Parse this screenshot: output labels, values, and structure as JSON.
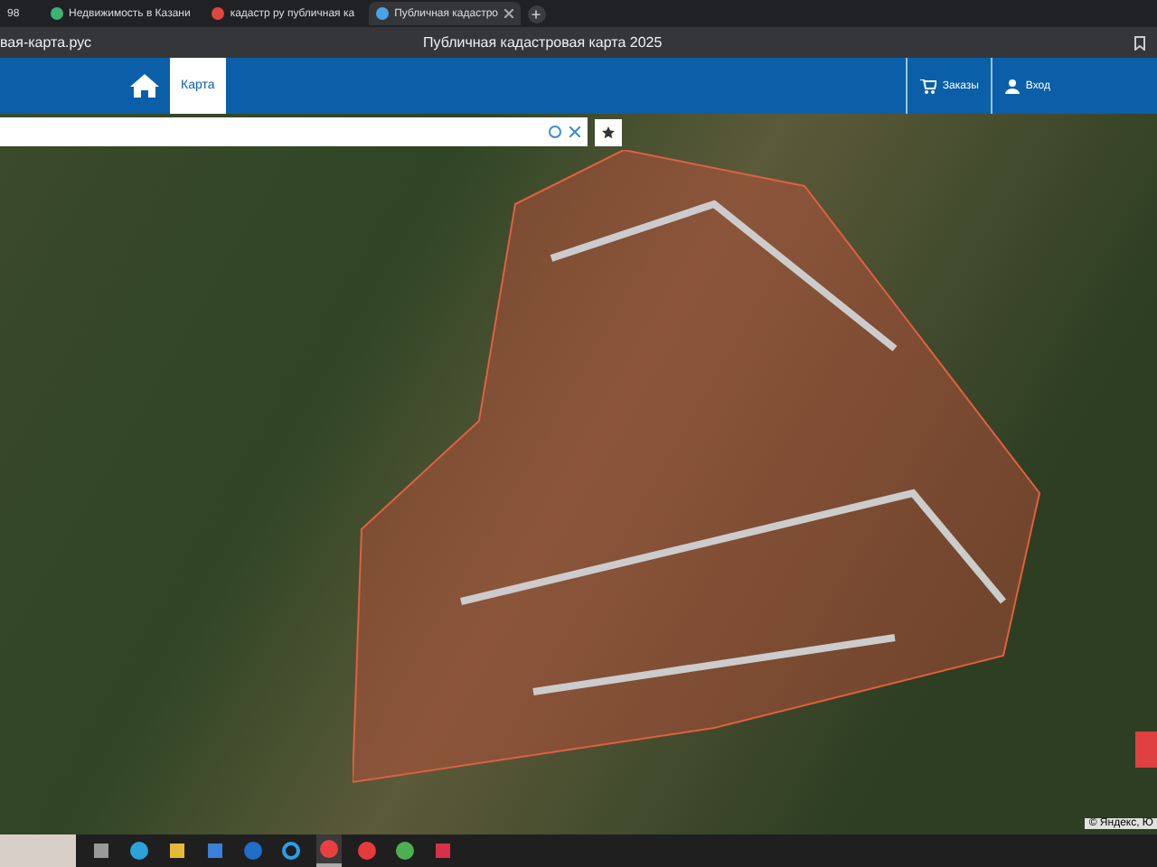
{
  "browser": {
    "tabs": [
      {
        "title": "98",
        "selected": false
      },
      {
        "title": "Недвижимость в Казани",
        "selected": false
      },
      {
        "title": "кадастр ру публичная ка",
        "selected": false
      },
      {
        "title": "Публичная кадастро",
        "selected": true
      }
    ],
    "new_tab": "+",
    "address": "вая-карта.рус",
    "page_title": "Публичная кадастровая карта 2025"
  },
  "header": {
    "nav": [
      {
        "label": "Карта",
        "selected": true
      }
    ],
    "actions": [
      {
        "kind": "cart",
        "label": "Заказы"
      },
      {
        "kind": "user",
        "label": "Вход"
      }
    ]
  },
  "map": {
    "attribution": "© Яндекс, Ю"
  },
  "taskbar": {
    "apps": [
      {
        "kind": "taskview",
        "active": false
      },
      {
        "kind": "edge",
        "active": false
      },
      {
        "kind": "folder",
        "active": false
      },
      {
        "kind": "store",
        "active": false
      },
      {
        "kind": "mail",
        "active": false
      },
      {
        "kind": "ring",
        "active": false
      },
      {
        "kind": "yandex",
        "active": true
      },
      {
        "kind": "ya",
        "active": false
      },
      {
        "kind": "chrome",
        "active": false
      },
      {
        "kind": "wb",
        "active": false
      }
    ]
  }
}
